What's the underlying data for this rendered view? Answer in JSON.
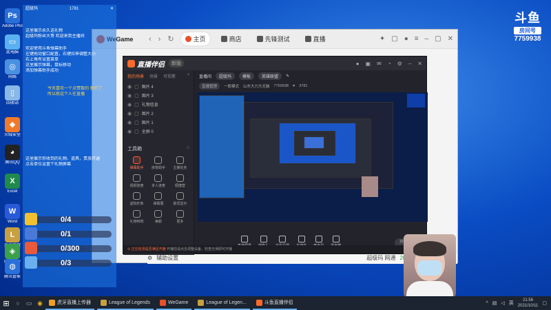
{
  "desktop": {
    "icons": [
      {
        "label": "Adobe Photo",
        "color": "#2a6fd8",
        "glyph": "Ps"
      },
      {
        "label": "此电脑",
        "color": "#5ab0f0",
        "glyph": "▭"
      },
      {
        "label": "网络",
        "color": "#4a90e0",
        "glyph": "◎"
      },
      {
        "label": "回收站",
        "color": "#8ab8e8",
        "glyph": "▯"
      },
      {
        "label": "火绒安全",
        "color": "#f07a2a",
        "glyph": "◆"
      },
      {
        "label": "腾讯QQ",
        "color": "#222222",
        "glyph": "◕"
      },
      {
        "label": "Excel",
        "color": "#1f8a4a",
        "glyph": "X"
      },
      {
        "label": "Word",
        "color": "#2a5ad8",
        "glyph": "W"
      },
      {
        "label": "英雄联盟",
        "color": "#c8a040",
        "glyph": "L"
      },
      {
        "label": "腾讯手游",
        "color": "#3aa04a",
        "glyph": "◈"
      },
      {
        "label": "腾讯管家",
        "color": "#2a70d8",
        "glyph": "◍"
      }
    ]
  },
  "room": {
    "logo": "斗鱼",
    "tag": "房间号",
    "number": "7759938"
  },
  "wegame": {
    "logo": "WeGame",
    "tabs": [
      "主页",
      "商店",
      "先锋测试",
      "直播"
    ],
    "bottom_left": "辅助设置",
    "bottom_right": "超级玛 网通",
    "bottom_ping": "20ms"
  },
  "companion": {
    "logo": "直播伴侣",
    "version": "新版",
    "scene_tabs": [
      "我的场景",
      "场景",
      "可视素"
    ],
    "scenes": [
      "图片 4",
      "图片 3",
      "礼物信息",
      "图片 2",
      "图片 1",
      "全屏 0"
    ],
    "tools_title": "工具箱",
    "tools": [
      {
        "label": "弹幕助手",
        "hot": true
      },
      {
        "label": "房管助手",
        "hot": false
      },
      {
        "label": "主播任务",
        "hot": false
      },
      {
        "label": "视频连麦",
        "hot": false
      },
      {
        "label": "多人连麦",
        "hot": false
      },
      {
        "label": "便捷营",
        "hot": false
      },
      {
        "label": "虚拟形象",
        "hot": false
      },
      {
        "label": "弹幕展",
        "hot": false
      },
      {
        "label": "歌词显示",
        "hot": false
      },
      {
        "label": "礼物特效",
        "hot": false
      },
      {
        "label": "美颜",
        "hot": false
      },
      {
        "label": "更多",
        "hot": false
      }
    ],
    "info": {
      "room_label": "直播间",
      "room_name": "超级玛",
      "category": "模板",
      "title_pill": "英雄联盟"
    },
    "info2": {
      "section": "直播管理",
      "mode": "一般模式",
      "host": "山东大力大无脑",
      "room_no": "7759938",
      "fans": "3781"
    },
    "actions": [
      "直播屏幕",
      "摄像头",
      "手机投屏",
      "多媒体",
      "麦克风",
      "扬声器"
    ],
    "start_label": "开始直播",
    "status_warn": "正在检测是否满足开播",
    "status_text": "开播前请点击调整设备，检查无误即可开播"
  },
  "overlay": {
    "top_label": "超级玛",
    "counter_num": "1781",
    "lines_a": [
      "这里展示永久送礼物",
      "超级玛粉丝大哥 欢迎来到主播间",
      "欢迎使用斗鱼弹幕助手",
      "左键拖动窗口配置，右键拉伸调整大小",
      "右上角有设置菜单",
      "这里展示弹幕，鼠标移动",
      "添加弹幕助手成功"
    ],
    "highlight_a": "今天喜欢一个点赞数的 就打了",
    "highlight_b": "所以就这个人在直播",
    "lines_b": [
      "这里展示你收到的礼物、道具，贵族开通",
      "点击单位设置个礼物屏幕"
    ]
  },
  "counters": [
    {
      "label": "0/4",
      "color": "#f0c030"
    },
    {
      "label": "0/1",
      "color": "#4a7ad8"
    },
    {
      "label": "0/300",
      "color": "#e85a3a"
    },
    {
      "label": "0/3",
      "color": "#6ab0f0"
    }
  ],
  "taskbar": {
    "apps": [
      {
        "label": "虎牙直播上传器",
        "color": "#f0a020"
      },
      {
        "label": "League of Legends",
        "color": "#c8a040"
      },
      {
        "label": "WeGame",
        "color": "#e8502a"
      },
      {
        "label": "League of Legen...",
        "color": "#c8a040"
      },
      {
        "label": "斗鱼直播伴侣",
        "color": "#ff6a2a"
      }
    ],
    "time": "21:56",
    "date": "2021/10/11",
    "lang": "英"
  }
}
